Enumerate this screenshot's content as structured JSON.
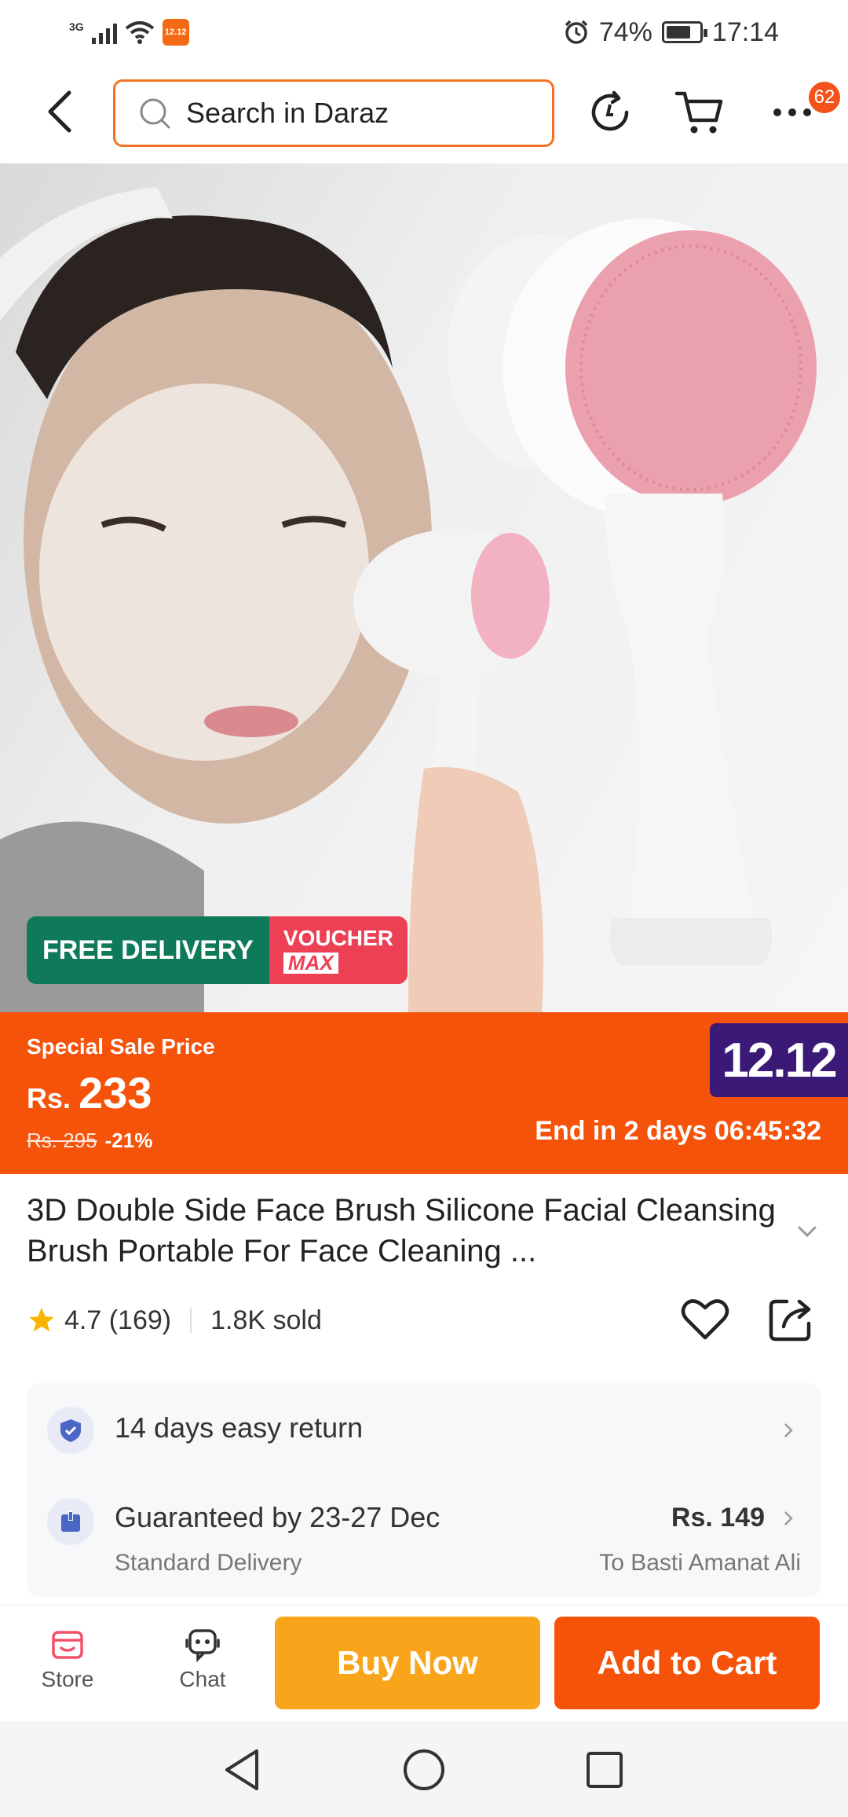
{
  "status_bar": {
    "network": "3G",
    "app_badge": "12.12",
    "battery_level": 0.74,
    "battery": "74%",
    "time": "17:14"
  },
  "top_nav": {
    "search_placeholder": "Search in Daraz",
    "more_badge": "62"
  },
  "hero": {
    "free_delivery": "FREE DELIVERY",
    "voucher": "VOUCHER",
    "voucher_sub": "MAX"
  },
  "price": {
    "label": "Special Sale Price",
    "currency": "Rs.",
    "current": "233",
    "original": "Rs. 295",
    "discount": "-21%",
    "event": "12.12",
    "countdown": "End in 2 days 06:45:32"
  },
  "product": {
    "title": "3D Double Side Face Brush Silicone Facial Cleansing Brush Portable For Face Cleaning ...",
    "rating": "4.7 (169)",
    "sold": "1.8K sold"
  },
  "services": {
    "return": "14 days easy return",
    "delivery_title": "Guaranteed by 23-27 Dec",
    "delivery_type": "Standard Delivery",
    "delivery_fee": "Rs. 149",
    "destination": "To Basti Amanat Ali"
  },
  "action_bar": {
    "store": "Store",
    "chat": "Chat",
    "buy_now": "Buy Now",
    "add_to_cart": "Add to Cart"
  },
  "colors": {
    "accent": "#f5520a",
    "buy_now": "#f9a51b",
    "free_delivery": "#0f7a5a",
    "voucher": "#ee4055",
    "event_badge": "#3b1a77"
  }
}
